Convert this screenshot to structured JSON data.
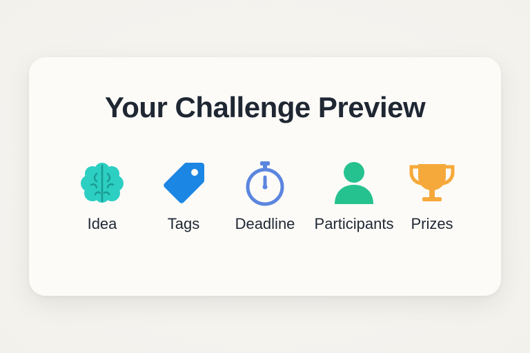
{
  "preview": {
    "title": "Your Challenge Preview",
    "items": [
      {
        "label": "Idea",
        "icon": "brain-icon",
        "color": "#2ccfc2"
      },
      {
        "label": "Tags",
        "icon": "tag-icon",
        "color": "#1b86e3"
      },
      {
        "label": "Deadline",
        "icon": "stopwatch-icon",
        "color": "#5b86df"
      },
      {
        "label": "Participants",
        "icon": "user-icon",
        "color": "#25c28f"
      },
      {
        "label": "Prizes",
        "icon": "trophy-icon",
        "color": "#f6a93b"
      }
    ]
  }
}
